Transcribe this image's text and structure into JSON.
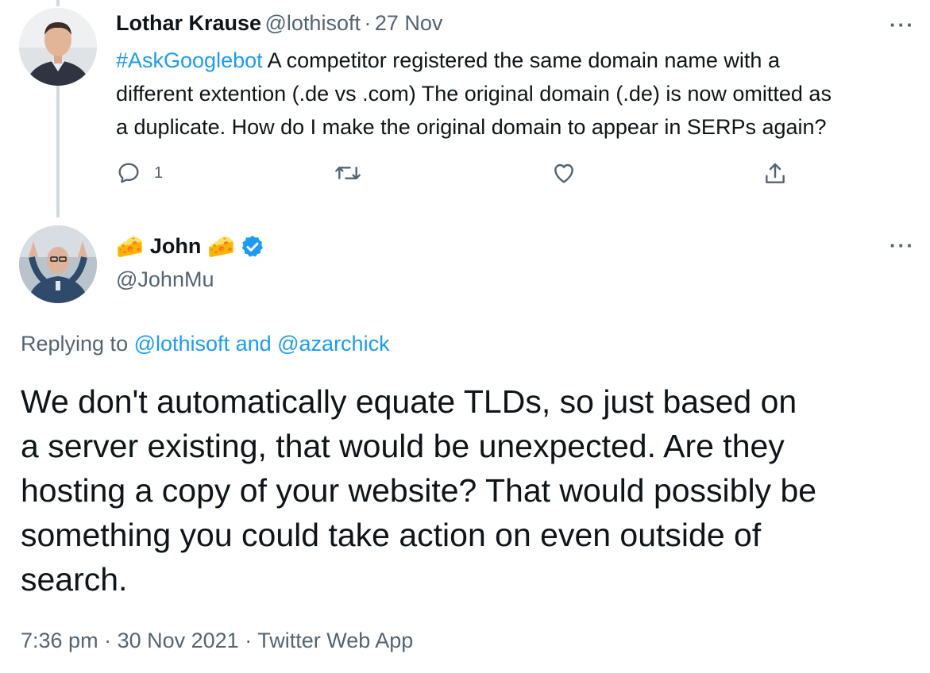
{
  "parent_tweet": {
    "author_name": "Lothar Krause",
    "author_handle": "@lothisoft",
    "separator": "·",
    "date": "27 Nov",
    "hashtag": "#AskGooglebot",
    "text_line1": " A competitor registered the same domain name with a",
    "text_line2": "different extention (.de vs .com) The original domain (.de) is now omitted as",
    "text_line3": "a duplicate.  How do I make the original domain to appear in SERPs again?",
    "reply_count": "1",
    "more_label": "···"
  },
  "main_tweet": {
    "name_prefix_emoji": "🧀",
    "author_name": "John",
    "name_suffix_emoji": "🧀",
    "author_handle": "@JohnMu",
    "more_label": "···",
    "replying_prefix": "Replying to ",
    "reply_to_1": "@lothisoft",
    "reply_joiner": " and ",
    "reply_to_2": "@azarchick",
    "text_line1": "We don't automatically equate TLDs, so just based on",
    "text_line2": "a server existing, that would be unexpected. Are they",
    "text_line3": "hosting a copy of your website? That would possibly be",
    "text_line4": "something you could take action on even outside of",
    "text_line5": "search.",
    "time": "7:36 pm",
    "meta_sep1": " · ",
    "date": "30 Nov 2021",
    "meta_sep2": " · ",
    "source": "Twitter Web App"
  },
  "colors": {
    "link": "#1d9bf0",
    "muted": "#536471",
    "text": "#0f1419",
    "verified": "#1d9bf0",
    "thread_line": "#cfd9de"
  },
  "icons": [
    "reply-icon",
    "retweet-icon",
    "like-icon",
    "share-icon",
    "more-icon",
    "verified-badge-icon",
    "cheese-emoji"
  ]
}
